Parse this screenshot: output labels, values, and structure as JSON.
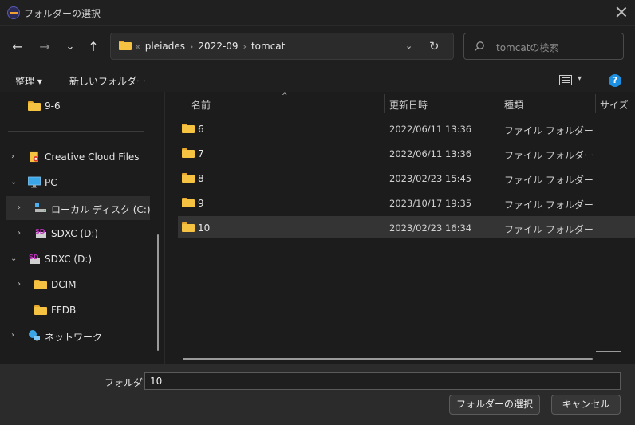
{
  "window": {
    "title": "フォルダーの選択",
    "icon": "eclipse-app-icon"
  },
  "nav": {
    "back_icon": "←",
    "forward_icon": "→",
    "recent_icon": "⌄",
    "up_icon": "↑"
  },
  "address": {
    "overflow": "«",
    "crumbs": [
      "pleiades",
      "2022-09",
      "tomcat"
    ],
    "separator": "›",
    "dropdown_icon": "⌄",
    "refresh_icon": "↻"
  },
  "search": {
    "placeholder": "tomcatの検索"
  },
  "toolbar": {
    "organize_label": "整理 ▾",
    "new_folder_label": "新しいフォルダー",
    "view_dd": "▾",
    "help": "?"
  },
  "sidebar": {
    "top_item": "9-6",
    "items": [
      {
        "label": "Creative Cloud Files",
        "chevron": "›",
        "icon": "creative-cloud-folder-icon"
      },
      {
        "label": "PC",
        "chevron": "⌄",
        "icon": "pc-monitor-icon"
      },
      {
        "label": "ローカル ディスク (C:)",
        "chevron": "›",
        "icon": "local-disk-icon"
      },
      {
        "label": "SDXC (D:)",
        "chevron": "›",
        "icon": "sd-card-icon",
        "badge": "SD"
      },
      {
        "label": "SDXC (D:)",
        "chevron": "⌄",
        "icon": "sd-card-icon",
        "badge": "SD"
      },
      {
        "label": "DCIM",
        "chevron": "›",
        "icon": "folder-icon"
      },
      {
        "label": "FFDB",
        "chevron": "",
        "icon": "folder-icon"
      },
      {
        "label": "ネットワーク",
        "chevron": "›",
        "icon": "network-icon"
      }
    ]
  },
  "columns": {
    "sort_caret": "^",
    "name": "名前",
    "modified": "更新日時",
    "type": "種類",
    "size": "サイズ"
  },
  "files": [
    {
      "name": "6",
      "modified": "2022/06/11 13:36",
      "type": "ファイル フォルダー"
    },
    {
      "name": "7",
      "modified": "2022/06/11 13:36",
      "type": "ファイル フォルダー"
    },
    {
      "name": "8",
      "modified": "2023/02/23 15:45",
      "type": "ファイル フォルダー"
    },
    {
      "name": "9",
      "modified": "2023/10/17 19:35",
      "type": "ファイル フォルダー"
    },
    {
      "name": "10",
      "modified": "2023/02/23 16:34",
      "type": "ファイル フォルダー"
    }
  ],
  "footer": {
    "folder_label": "フォルダー:",
    "folder_value": "10",
    "select_button": "フォルダーの選択",
    "cancel_button": "キャンセル"
  },
  "colors": {
    "folder": "#f5c242",
    "accent": "#1d8fe0",
    "background": "#1f1f1f"
  }
}
